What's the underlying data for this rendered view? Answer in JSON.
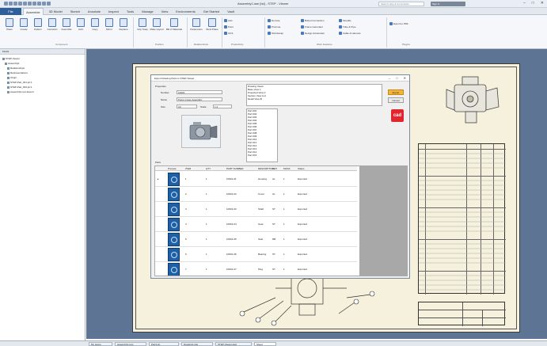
{
  "title_bar": {
    "app_title": "Assembly1.iam [Ist] - STEP - Viewer",
    "help_search_placeholder": "Search Help & Commands...",
    "user": "Sign In",
    "minimize": "–",
    "maximize": "□",
    "close": "✕"
  },
  "ribbon": {
    "file_tab": "File",
    "tabs": [
      "3D Model",
      "Sketch",
      "Annotate",
      "Inspect",
      "Tools",
      "Manage",
      "View",
      "Environments",
      "Get Started",
      "Vault"
    ],
    "active_tab": "Assemble",
    "buttons_large": [
      "Place",
      "Create",
      "Pattern",
      "Constrain",
      "Assemble",
      "Joint",
      "Copy",
      "Mirror",
      "Replace",
      "Grip Snap",
      "Make Layout",
      "Bill of Materials",
      "Parameters",
      "Work Plane"
    ],
    "buttons_small": [
      "Axis",
      "Point",
      "UCS",
      "Demote",
      "Promote",
      "Shrinkwrap",
      "Bolted Connection",
      "Frame Generator",
      "Design Accelerator",
      "Simplify",
      "Tube & Pipe",
      "Cable & Harness",
      "Export to PDF"
    ],
    "groups": [
      "Component",
      "Position",
      "Relationships",
      "Productivity",
      "Work Features",
      "Plugins"
    ]
  },
  "browser": {
    "title": "Model",
    "nodes": [
      "STEP-Viewer",
      "Assembly1",
      "Relationships",
      "Representations",
      "Origin",
      "STEP-Part_001.ipt:1",
      "STEP-Part_002.ipt:1",
      "Assembly1.iam Export"
    ]
  },
  "dialog": {
    "title": "Export Drawing Parts to STEP-Viewer",
    "section_properties": "Properties",
    "label_number": "Number",
    "value_number": "10001",
    "label_name": "Name",
    "value_name": "Pump Cover Assembly",
    "label_size": "Size",
    "value_size": "A3",
    "label_scale": "Scale",
    "value_scale": "1:2",
    "list_header": "Drawing Views",
    "list_items": [
      "Base View 1",
      "Projected View 2",
      "Section View A-A",
      "Detail View B"
    ],
    "part_list": [
      "Part 001",
      "Part 002",
      "Part 003",
      "Part 004",
      "Part 005",
      "Part 006",
      "Part 007",
      "Part 008",
      "Part 009",
      "Part 010",
      "Part 011",
      "Part 012",
      "Part 013",
      "Part 014",
      "Part 015"
    ],
    "btn_primary": "Export",
    "btn_secondary": "Cancel",
    "logo": "cad",
    "grid_header": "Parts",
    "grid_columns": [
      "",
      "Preview",
      "ITEM",
      "QTY",
      "PART NUMBER",
      "DESCRIPTION",
      "MAT",
      "MASS",
      "Status"
    ],
    "grid_rows": [
      {
        "item": "1",
        "qty": "1",
        "part": "10001-01",
        "desc": "Housing",
        "mat": "AL",
        "mass": "1",
        "status": "Exported"
      },
      {
        "item": "2",
        "qty": "1",
        "part": "10001-02",
        "desc": "Cover",
        "mat": "AL",
        "mass": "1",
        "status": "Exported"
      },
      {
        "item": "3",
        "qty": "1",
        "part": "10001-03",
        "desc": "Shaft",
        "mat": "ST",
        "mass": "1",
        "status": "Exported"
      },
      {
        "item": "4",
        "qty": "1",
        "part": "10001-04",
        "desc": "Gear",
        "mat": "ST",
        "mass": "1",
        "status": "Exported"
      },
      {
        "item": "5",
        "qty": "1",
        "part": "10001-05",
        "desc": "Seal",
        "mat": "RB",
        "mass": "1",
        "status": "Exported"
      },
      {
        "item": "6",
        "qty": "1",
        "part": "10001-06",
        "desc": "Bearing",
        "mat": "ST",
        "mass": "1",
        "status": "Exported"
      },
      {
        "item": "7",
        "qty": "1",
        "part": "10001-07",
        "desc": "Plug",
        "mat": "ST",
        "mass": "1",
        "status": "Exported"
      }
    ]
  },
  "status_tabs": [
    "My Home",
    "Assembly1.iam",
    "Part1.ipt",
    "Drawing1.idw",
    "STEP-Viewer.dwg",
    "Sheet"
  ],
  "colors": {
    "accent": "#2f5f9b",
    "canvas": "#5e7494",
    "sheet": "#f5f1dc",
    "highlight": "#f5b33b",
    "logo_bg": "#e3262e"
  }
}
